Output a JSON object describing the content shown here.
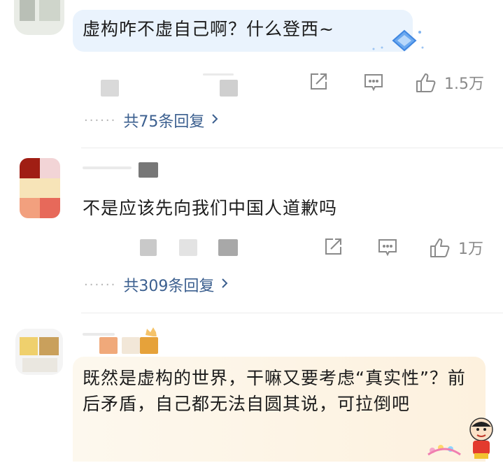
{
  "comments": [
    {
      "text": "虚构咋不虚自己啊？什么登西~",
      "likes": "1.5万",
      "replies_label": "共75条回复"
    },
    {
      "text": "不是应该先向我们中国人道歉吗",
      "likes": "1万",
      "replies_label": "共309条回复"
    },
    {
      "text": "既然是虚构的世界，干嘛又要考虑“真实性”？前后矛盾，自己都无法自圆其说，可拉倒吧"
    }
  ],
  "icons": {
    "share": "share-icon",
    "comment": "comment-icon",
    "like": "thumbs-up-icon",
    "chevron": "chevron-right-icon"
  },
  "colors": {
    "reply_link": "#3b5f8f",
    "meta_text": "#8a8a8a",
    "bubble_blue": "#eaf3fd",
    "bubble_yellow": "#fdf5e4"
  }
}
